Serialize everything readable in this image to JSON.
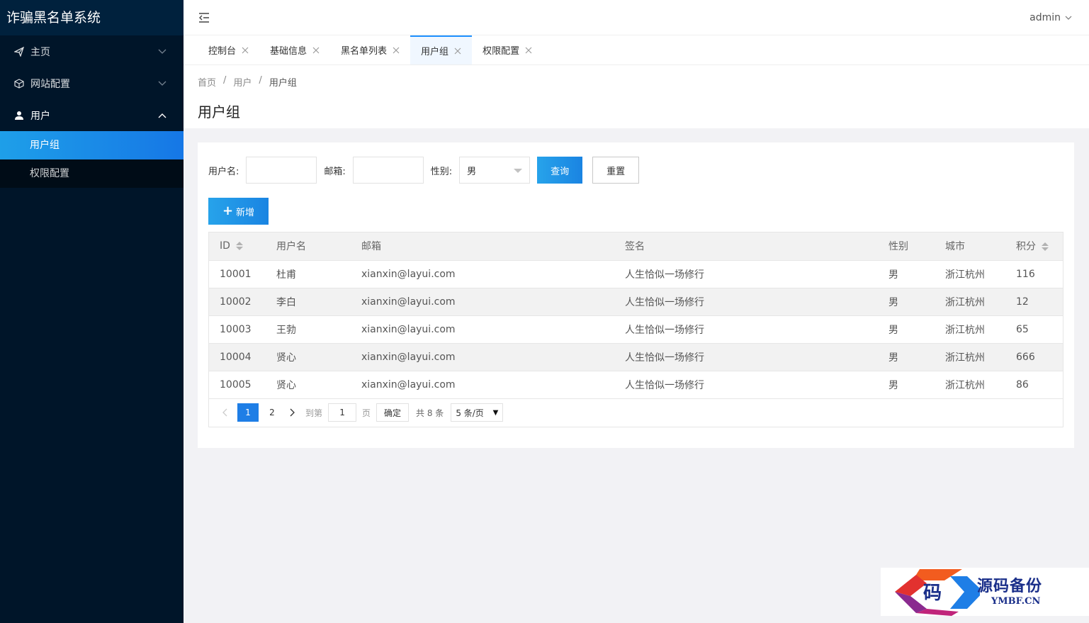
{
  "app": {
    "title": "诈骗黑名单系统"
  },
  "sidebar": {
    "items": [
      {
        "label": "主页",
        "icon": "send-icon"
      },
      {
        "label": "网站配置",
        "icon": "cube-icon"
      },
      {
        "label": "用户",
        "icon": "user-icon"
      }
    ],
    "submenu": [
      {
        "label": "用户组",
        "active": true
      },
      {
        "label": "权限配置",
        "active": false
      }
    ]
  },
  "header": {
    "user": "admin"
  },
  "tabs": [
    {
      "label": "控制台"
    },
    {
      "label": "基础信息"
    },
    {
      "label": "黑名单列表"
    },
    {
      "label": "用户组",
      "active": true
    },
    {
      "label": "权限配置"
    }
  ],
  "breadcrumb": [
    "首页",
    "用户",
    "用户组"
  ],
  "page": {
    "title": "用户组"
  },
  "filters": {
    "username_label": "用户名:",
    "email_label": "邮箱:",
    "gender_label": "性别:",
    "gender_value": "男",
    "search_button": "查询",
    "reset_button": "重置"
  },
  "add_button": "新增",
  "table": {
    "columns": [
      "ID",
      "用户名",
      "邮箱",
      "签名",
      "性别",
      "城市",
      "积分"
    ],
    "rows": [
      [
        "10001",
        "杜甫",
        "xianxin@layui.com",
        "人生恰似一场修行",
        "男",
        "浙江杭州",
        "116"
      ],
      [
        "10002",
        "李白",
        "xianxin@layui.com",
        "人生恰似一场修行",
        "男",
        "浙江杭州",
        "12"
      ],
      [
        "10003",
        "王勃",
        "xianxin@layui.com",
        "人生恰似一场修行",
        "男",
        "浙江杭州",
        "65"
      ],
      [
        "10004",
        "贤心",
        "xianxin@layui.com",
        "人生恰似一场修行",
        "男",
        "浙江杭州",
        "666"
      ],
      [
        "10005",
        "贤心",
        "xianxin@layui.com",
        "人生恰似一场修行",
        "男",
        "浙江杭州",
        "86"
      ]
    ]
  },
  "pagination": {
    "pages": [
      "1",
      "2"
    ],
    "current": "1",
    "goto_label": "到第",
    "goto_value": "1",
    "page_label": "页",
    "confirm": "确定",
    "total": "共 8 条",
    "limit": "5 条/页"
  },
  "watermark": {
    "text": "源码备份",
    "url": "YMBF.CN",
    "logo_char": "码"
  },
  "colors": {
    "sidebar": "#001529",
    "accent": "#1e90ff",
    "active_gradient": "#1677e6"
  }
}
